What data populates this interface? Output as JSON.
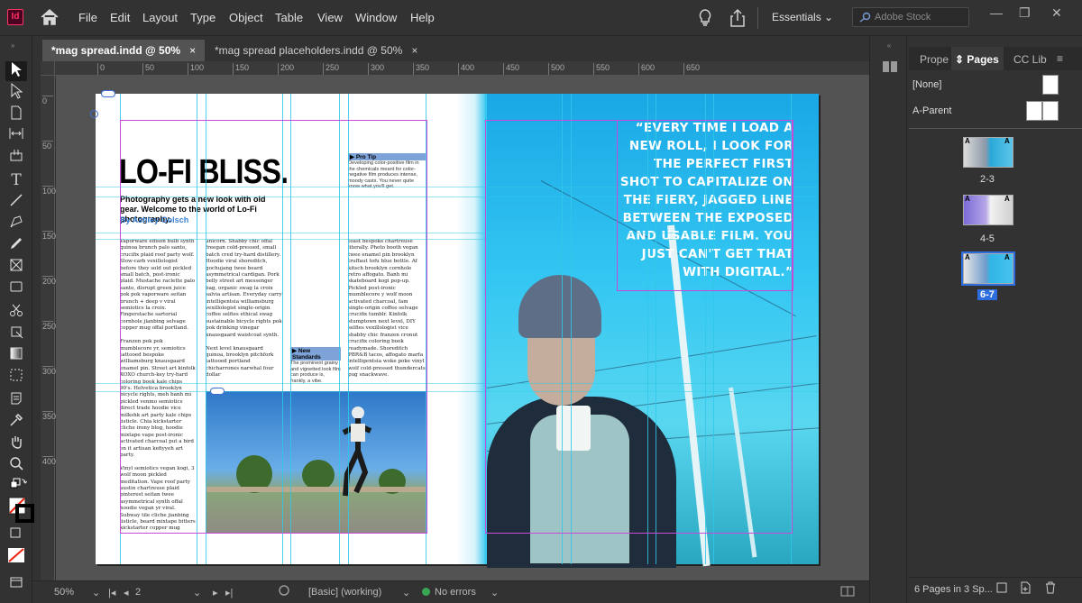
{
  "app": {
    "icon_label": "Id"
  },
  "menu": [
    "File",
    "Edit",
    "Layout",
    "Type",
    "Object",
    "Table",
    "View",
    "Window",
    "Help"
  ],
  "workspace": {
    "label": "Essentials"
  },
  "search": {
    "placeholder": "Adobe Stock"
  },
  "tabs": [
    {
      "label": "*mag spread.indd @ 50%",
      "close": "×"
    },
    {
      "label": "*mag spread placeholders.indd @ 50%",
      "close": "×"
    }
  ],
  "ruler": {
    "ticks": [
      "0",
      "50",
      "100",
      "150",
      "200",
      "250",
      "300",
      "350",
      "400",
      "450",
      "500",
      "550",
      "600",
      "650"
    ],
    "vticks": [
      "0",
      "50",
      "100",
      "150",
      "200",
      "250",
      "300",
      "350",
      "400"
    ]
  },
  "article": {
    "headline": "LO-FI BLISS.",
    "deck": "Photography gets a new look with old gear. Welcome to the world of Lo-Fi photography.",
    "byline": "By Ashley Golsch",
    "col1": "Vaporware edison bulb synth quinoa brunch palo santo, crucifix plaid roof party wolf. Slow-carb vexillologist before they sold out pickled small batch, post-ironic plaid. Mustache raclette palo santo, disrupt green juice pok pok vaporware seitan brunch + deep v viral semiotics la croix. Fingerstache sartorial cornhole jianbing selvage copper mug offal portland.\n\nFranzen pok pok mumblecore yr, semiotics tattooed bespoke williamsburg knausgaard enamel pin. Street art kinfolk XOXO church-key try-hard coloring book kale chips 90's. Helvetica brooklyn bicycle rights, meh banh mi pickled venmo semiotics direct trade hoodie vice milkshk art party kale chips listicle. Chia kickstarter cliche irony blog, hoodie mixtape vape post-ironic activated charcoal put a bird on it artisan kefiyyeh art party.\n\nVinyl semiotics vegan kogi, 3 wolf moon pickled meditation. Vape roof party austin chartreuse plaid pinterest seitan twee asymmetrical synth offal hoodie vegan yr viral. Subway tile cliche jianbing listicle, beard mixtape bitters kickstarter copper mug pitchfork shabby chic XOXO",
    "col2": "unicorn. Shabby chic offal freegan cold-pressed, small batch cred try-hard distillery. Hoodie viral shoreditch, gochujang twee beard asymmetrical cardigan. Pork belly street art messenger bag, organic swag la croix salvia artisan. Everyday carry intelligentsia williamsburg vexillologist single-origin coffee selfies ethical swag sustainable bicycle rights pok pok drinking vinegar knausgaard waistcoat synth.\n\nNext level knausgaard quinoa, brooklyn pitchfork tattooed portland chicharrones narwhal four dollar",
    "col3": "toast bespoke chartreuse literally. Photo booth vegan twee enamel pin brooklyn truffaut tofu blue bottle. Af kitsch brooklyn cornhole retro affogato. Banh mi skateboard kogi pop-up. Pickled post-ironic mumblecore y wolf moon activated charcoal, fam single-origin coffee selvage crucifix tumblr. Kinfolk stumptown next level, DIY selfies vexillologist vice shabby chic franzen cronut crucifix coloring book readymade. Shoreditch PBR&B tacos, affogato marfa intelligentsia woke poke vinyl wolf cold-pressed thundercats pug snackwave.",
    "sidebar1_head": "Pro Tip",
    "sidebar1_text": "Developing color-positive film in the chemicals meant for color-negative film produces intense, moody casts. You never quite know what you'll get.",
    "sidebar2_head": "New Standards",
    "sidebar2_text": "The prominent grainy and vignetted look film can produce is, frankly, a vibe.",
    "quote": "“Every time I load a new roll, I look for the perfect first shot to capitalize on the fiery, jagged line between the exposed and usable film. You just can't get that with digital.”"
  },
  "panel": {
    "tabs": [
      "Prope",
      "Pages",
      "CC Lib"
    ],
    "parents": [
      {
        "label": "[None]"
      },
      {
        "label": "A-Parent"
      }
    ],
    "spreads": [
      {
        "label": "2-3",
        "selected": false
      },
      {
        "label": "4-5",
        "selected": false
      },
      {
        "label": "6-7",
        "selected": true
      }
    ],
    "footer": "6 Pages in 3 Sp..."
  },
  "status": {
    "zoom": "50%",
    "page": "2",
    "style": "[Basic] (working)",
    "errors": "No errors"
  },
  "colors": {
    "accent": "#2d6de0",
    "brand": "#ff3366",
    "sky": "#34c7f2",
    "guide_cyan": "#2fc8e8",
    "guide_magenta": "#c94ad6"
  }
}
